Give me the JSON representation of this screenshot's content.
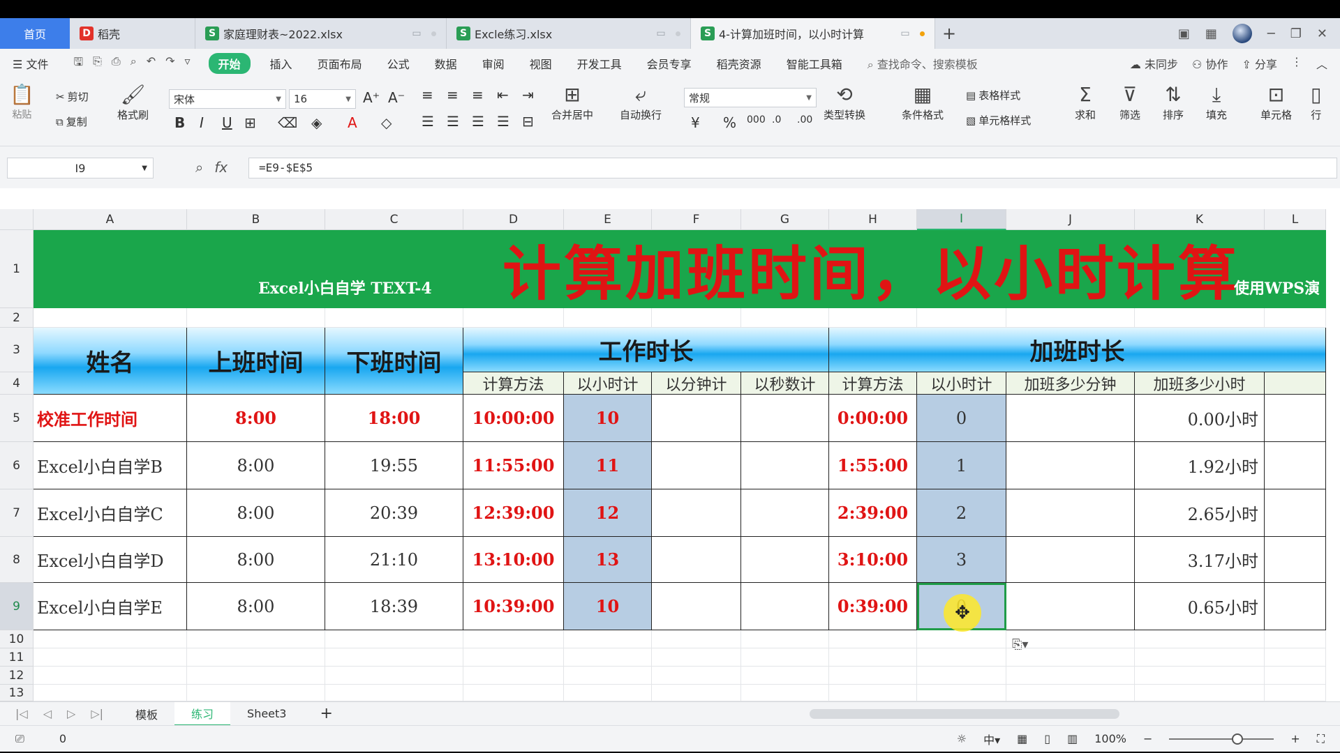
{
  "tabs": [
    {
      "label": "首页"
    },
    {
      "label": "稻壳"
    },
    {
      "label": "家庭理财表~2022.xlsx"
    },
    {
      "label": "Excle练习.xlsx"
    },
    {
      "label": "4-计算加班时间，以小时计算"
    }
  ],
  "menu": {
    "file": "文件",
    "items": [
      "开始",
      "插入",
      "页面布局",
      "公式",
      "数据",
      "审阅",
      "视图",
      "开发工具",
      "会员专享",
      "稻壳资源",
      "智能工具箱"
    ],
    "search": "查找命令、搜索模板",
    "unsync": "未同步",
    "collab": "协作",
    "share": "分享"
  },
  "toolbar": {
    "paste": "粘贴",
    "cut": "剪切",
    "copy": "复制",
    "format_painter": "格式刷",
    "font_name": "宋体",
    "font_size": "16",
    "merge": "合并居中",
    "wrap": "自动换行",
    "number_format": "常规",
    "type_convert": "类型转换",
    "cond_format": "条件格式",
    "table_style": "表格样式",
    "cell_style": "单元格样式",
    "sum": "求和",
    "filter": "筛选",
    "sort": "排序",
    "fill": "填充",
    "cell": "单元格",
    "row_col": "行"
  },
  "formula_bar": {
    "name_box": "I9",
    "formula": "=E9-$E$5"
  },
  "columns": [
    "A",
    "B",
    "C",
    "D",
    "E",
    "F",
    "G",
    "H",
    "I",
    "J",
    "K",
    "L"
  ],
  "rows": [
    "1",
    "2",
    "3",
    "4",
    "5",
    "6",
    "7",
    "8",
    "9",
    "10",
    "11",
    "12",
    "13"
  ],
  "sheet": {
    "banner_left": "Excel小白自学 TEXT-4",
    "banner_title": "计算加班时间，以小时计算",
    "banner_right": "使用WPS演",
    "headers": {
      "name": "姓名",
      "start": "上班时间",
      "end": "下班时间",
      "work": "工作时长",
      "overtime": "加班时长"
    },
    "subheaders": [
      "计算方法",
      "以小时计",
      "以分钟计",
      "以秒数计",
      "计算方法",
      "以小时计",
      "加班多少分钟",
      "加班多少小时"
    ],
    "rows": [
      {
        "name": "校准工作时间",
        "start": "8:00",
        "end": "18:00",
        "work": "10:00:00",
        "hours": "10",
        "ot": "0:00:00",
        "ot_hours": "0",
        "ot_hours_dec": "0.00小时"
      },
      {
        "name": "Excel小白自学B",
        "start": "8:00",
        "end": "19:55",
        "work": "11:55:00",
        "hours": "11",
        "ot": "1:55:00",
        "ot_hours": "1",
        "ot_hours_dec": "1.92小时"
      },
      {
        "name": "Excel小白自学C",
        "start": "8:00",
        "end": "20:39",
        "work": "12:39:00",
        "hours": "12",
        "ot": "2:39:00",
        "ot_hours": "2",
        "ot_hours_dec": "2.65小时"
      },
      {
        "name": "Excel小白自学D",
        "start": "8:00",
        "end": "21:10",
        "work": "13:10:00",
        "hours": "13",
        "ot": "3:10:00",
        "ot_hours": "3",
        "ot_hours_dec": "3.17小时"
      },
      {
        "name": "Excel小白自学E",
        "start": "8:00",
        "end": "18:39",
        "work": "10:39:00",
        "hours": "10",
        "ot": "0:39:00",
        "ot_hours": "0",
        "ot_hours_dec": "0.65小时"
      }
    ]
  },
  "sheet_tabs": [
    "模板",
    "练习",
    "Sheet3"
  ],
  "status": {
    "value": "0",
    "zoom": "100%"
  },
  "colors": {
    "accent": "#2bb673",
    "banner": "#1aa64b",
    "red_text": "#e01414",
    "hour_fill": "#b7cde3"
  }
}
